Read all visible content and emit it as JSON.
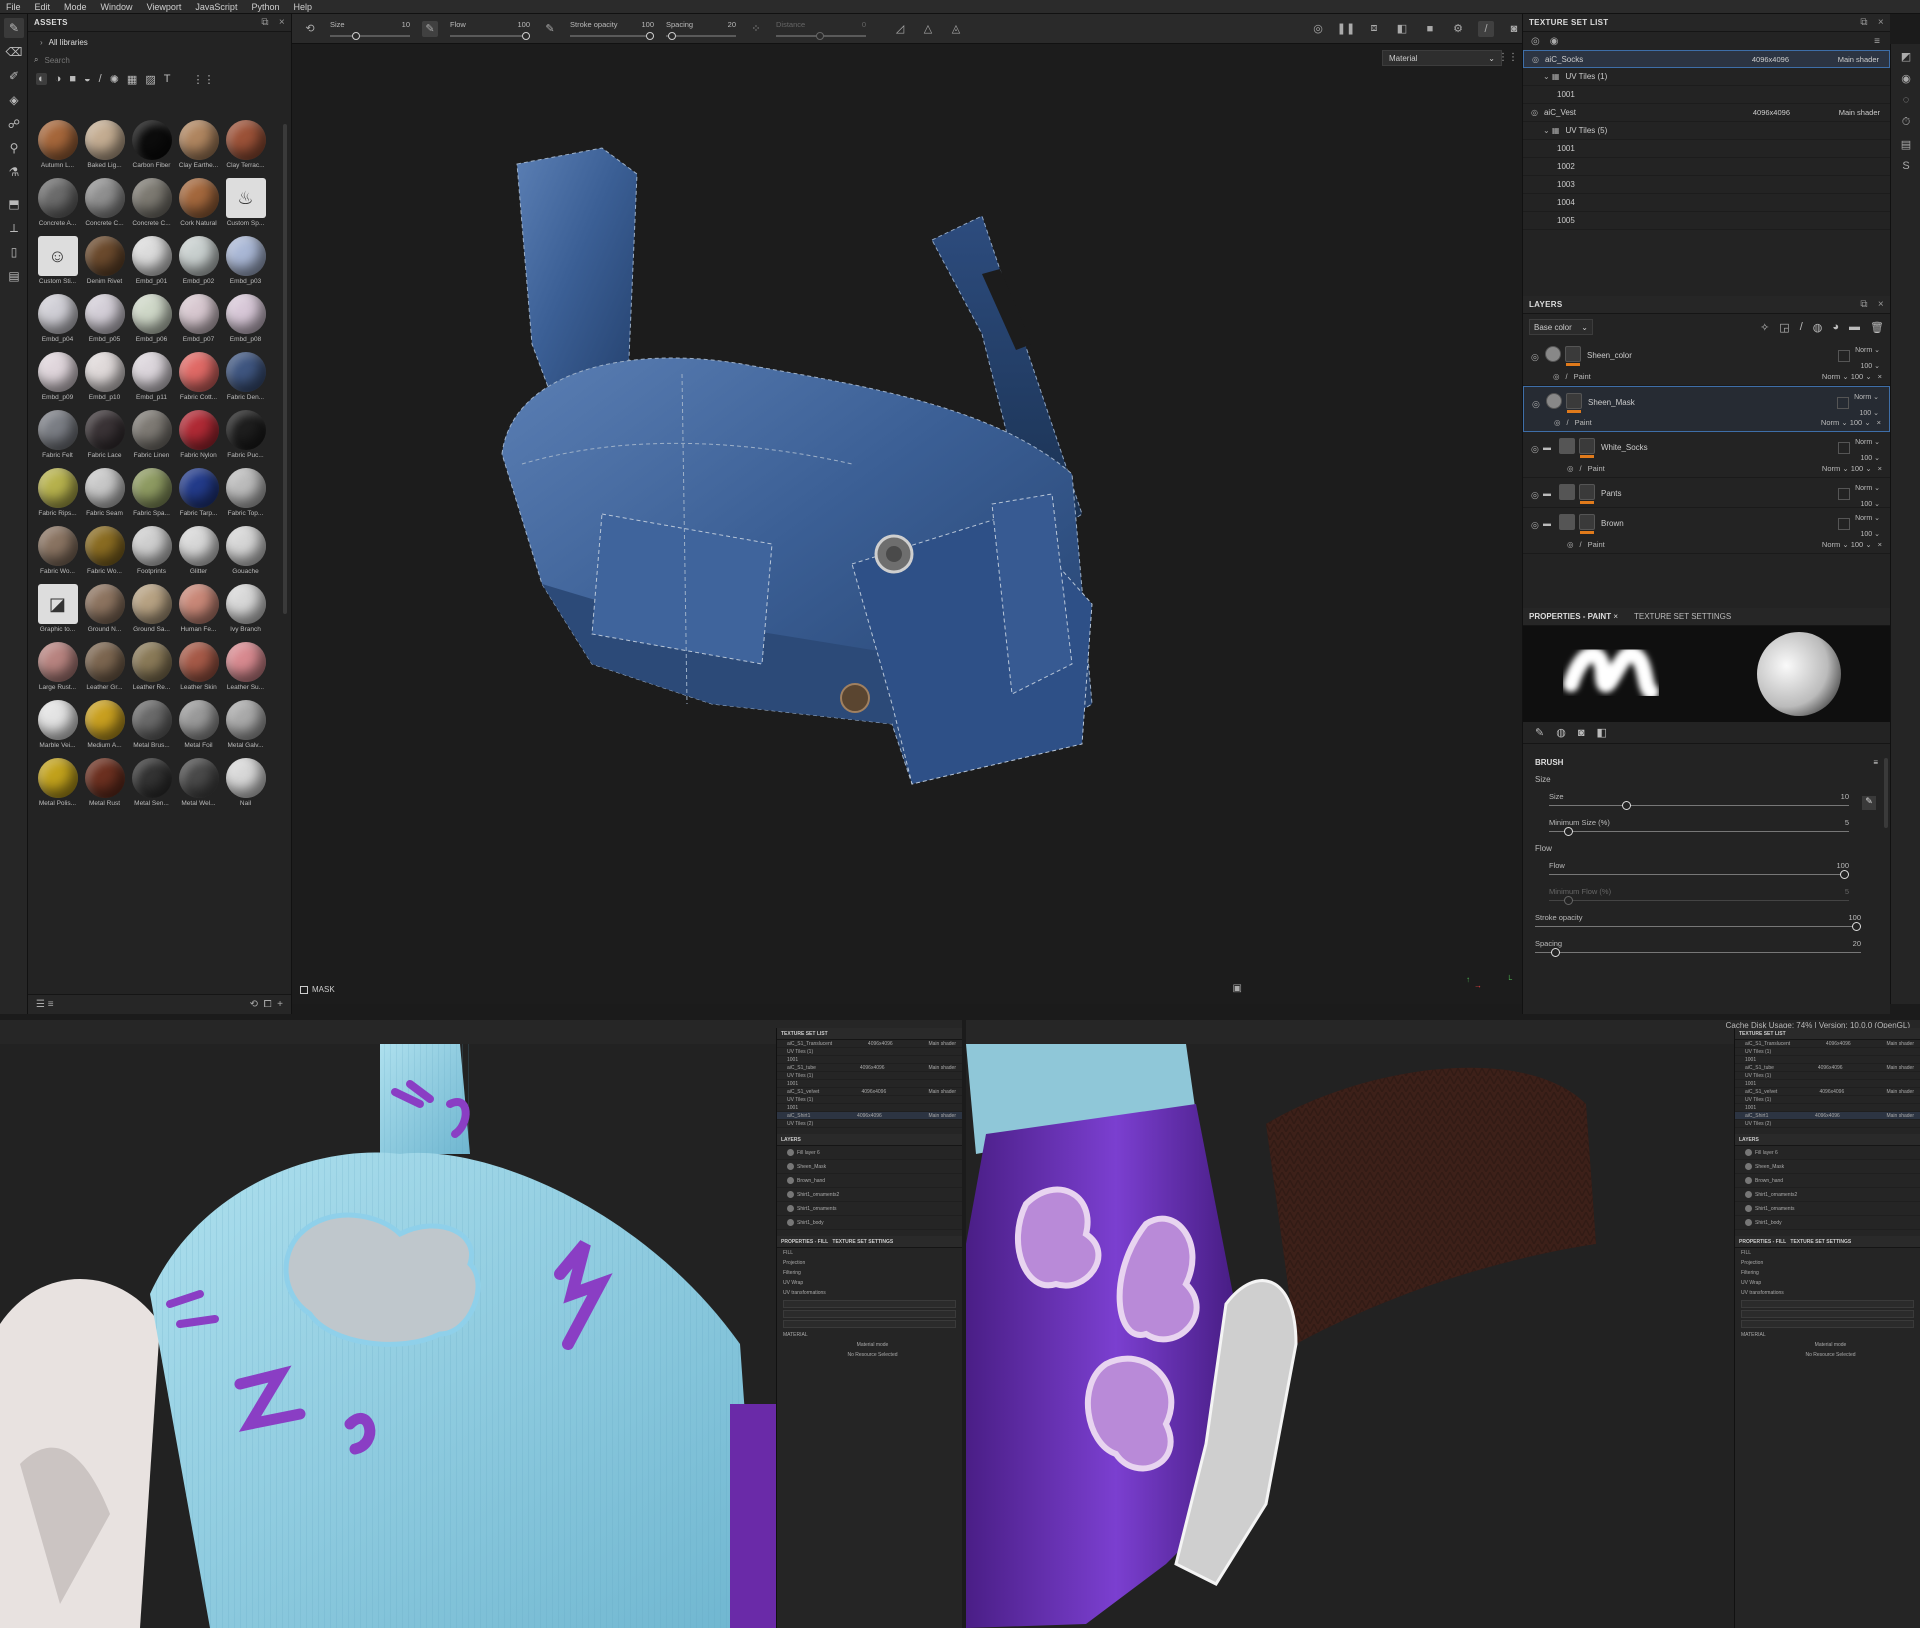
{
  "menu": [
    "File",
    "Edit",
    "Mode",
    "Window",
    "Viewport",
    "JavaScript",
    "Python",
    "Help"
  ],
  "assets": {
    "title": "ASSETS",
    "breadcrumb": "All libraries",
    "search_placeholder": "Search",
    "items": [
      {
        "label": "Autumn L...",
        "color": "#a6673b"
      },
      {
        "label": "Baked Lig...",
        "color": "#c4ad92"
      },
      {
        "label": "Carbon Fiber",
        "color": "#0c0c0c"
      },
      {
        "label": "Clay Earthe...",
        "color": "#b08660"
      },
      {
        "label": "Clay Terrac...",
        "color": "#9c5238"
      },
      {
        "label": "Concrete A...",
        "color": "#6c6c6c"
      },
      {
        "label": "Concrete C...",
        "color": "#909090"
      },
      {
        "label": "Concrete C...",
        "color": "#7d7a72"
      },
      {
        "label": "Cork Natural",
        "color": "#a4683d"
      },
      {
        "label": "Custom Sp...",
        "color": "#dddddd",
        "icon": "spray-icon"
      },
      {
        "label": "Custom Sti...",
        "color": "#dddddd",
        "icon": "smiley-icon"
      },
      {
        "label": "Denim Rivet",
        "color": "#6b4a2d"
      },
      {
        "label": "Embd_p01",
        "color": "#dcdcdc"
      },
      {
        "label": "Embd_p02",
        "color": "#c9d0cf"
      },
      {
        "label": "Embd_p03",
        "color": "#aab8d6"
      },
      {
        "label": "Embd_p04",
        "color": "#d0cfd6"
      },
      {
        "label": "Embd_p05",
        "color": "#d4cfd8"
      },
      {
        "label": "Embd_p06",
        "color": "#cfd8c8"
      },
      {
        "label": "Embd_p07",
        "color": "#d8c8d0"
      },
      {
        "label": "Embd_p08",
        "color": "#d8c8d8"
      },
      {
        "label": "Embd_p09",
        "color": "#e0d6dc"
      },
      {
        "label": "Embd_p10",
        "color": "#e0dada"
      },
      {
        "label": "Embd_p11",
        "color": "#dcd6dc"
      },
      {
        "label": "Fabric Cott...",
        "color": "#e06a66"
      },
      {
        "label": "Fabric Den...",
        "color": "#3f5680"
      },
      {
        "label": "Fabric Felt",
        "color": "#7b7e85"
      },
      {
        "label": "Fabric Lace",
        "color": "#3a3336"
      },
      {
        "label": "Fabric Linen",
        "color": "#7e7a74"
      },
      {
        "label": "Fabric Nylon",
        "color": "#b02a35"
      },
      {
        "label": "Fabric Puc...",
        "color": "#1e1e1e"
      },
      {
        "label": "Fabric Rips...",
        "color": "#b7b24d"
      },
      {
        "label": "Fabric Seam",
        "color": "#c8c8c8"
      },
      {
        "label": "Fabric Spa...",
        "color": "#8e9b62"
      },
      {
        "label": "Fabric Tarp...",
        "color": "#233b8a"
      },
      {
        "label": "Fabric Top...",
        "color": "#bcbcbc"
      },
      {
        "label": "Fabric Wo...",
        "color": "#8a7462"
      },
      {
        "label": "Fabric Wo...",
        "color": "#8a6c22"
      },
      {
        "label": "Footprints",
        "color": "#cfcfcf"
      },
      {
        "label": "Glitter",
        "color": "#d8d8d8"
      },
      {
        "label": "Gouache",
        "color": "#d6d6d6"
      },
      {
        "label": "Graphic to...",
        "color": "#dddddd",
        "icon": "graphic-tool-icon"
      },
      {
        "label": "Ground N...",
        "color": "#8d7460"
      },
      {
        "label": "Ground Sa...",
        "color": "#b7a283"
      },
      {
        "label": "Human Fe...",
        "color": "#c98878"
      },
      {
        "label": "Ivy Branch",
        "color": "#d8d8d8"
      },
      {
        "label": "Large Rust...",
        "color": "#b88480"
      },
      {
        "label": "Leather Gr...",
        "color": "#7c6650"
      },
      {
        "label": "Leather Re...",
        "color": "#8a7a58"
      },
      {
        "label": "Leather Skin",
        "color": "#a65a48"
      },
      {
        "label": "Leather Su...",
        "color": "#d88a90"
      },
      {
        "label": "Marble Vei...",
        "color": "#e4e4e4"
      },
      {
        "label": "Medium A...",
        "color": "#c9a020"
      },
      {
        "label": "Metal Brus...",
        "color": "#6a6a6a"
      },
      {
        "label": "Metal Foil",
        "color": "#9a9a9a"
      },
      {
        "label": "Metal Galv...",
        "color": "#aaaaaa"
      },
      {
        "label": "Metal Polis...",
        "color": "#c2a21c"
      },
      {
        "label": "Metal Rust",
        "color": "#6c3020"
      },
      {
        "label": "Metal Sen...",
        "color": "#333333"
      },
      {
        "label": "Metal Wel...",
        "color": "#4a4a4a"
      },
      {
        "label": "Nail",
        "color": "#d8d8d8"
      }
    ]
  },
  "toolbar": {
    "size": {
      "label": "Size",
      "value": "10"
    },
    "flow": {
      "label": "Flow",
      "value": "100"
    },
    "stroke_opacity": {
      "label": "Stroke opacity",
      "value": "100"
    },
    "spacing": {
      "label": "Spacing",
      "value": "20"
    },
    "distance": {
      "label": "Distance",
      "value": "0"
    }
  },
  "viewport": {
    "mode": "Material",
    "mask_label": "MASK"
  },
  "texture_set_list": {
    "title": "TEXTURE SET LIST",
    "rows": [
      {
        "name": "aiC_Socks",
        "res": "4096x4096",
        "shader": "Main shader",
        "level": 0,
        "selected": true
      },
      {
        "name": "UV Tiles (1)",
        "level": 1
      },
      {
        "name": "1001",
        "level": 2
      },
      {
        "name": "aiC_Vest",
        "res": "4096x4096",
        "shader": "Main shader",
        "level": 0
      },
      {
        "name": "UV Tiles (5)",
        "level": 1
      },
      {
        "name": "1001",
        "level": 2
      },
      {
        "name": "1002",
        "level": 2
      },
      {
        "name": "1003",
        "level": 2
      },
      {
        "name": "1004",
        "level": 2
      },
      {
        "name": "1005",
        "level": 2
      }
    ]
  },
  "layers": {
    "title": "LAYERS",
    "channel": "Base color",
    "items": [
      {
        "name": "Sheen_color",
        "blend": "Norm",
        "opacity": "100",
        "sub": "Paint",
        "sub_blend": "Norm",
        "sub_opacity": "100",
        "folder": false
      },
      {
        "name": "Sheen_Mask",
        "blend": "Norm",
        "opacity": "100",
        "sub": "Paint",
        "sub_blend": "Norm",
        "sub_opacity": "100",
        "folder": false,
        "selected": true
      },
      {
        "name": "White_Socks",
        "blend": "Norm",
        "opacity": "100",
        "sub": "Paint",
        "sub_blend": "Norm",
        "sub_opacity": "100",
        "folder": true
      },
      {
        "name": "Pants",
        "blend": "Norm",
        "opacity": "100",
        "folder": true
      },
      {
        "name": "Brown",
        "blend": "Norm",
        "opacity": "100",
        "sub": "Paint",
        "sub_blend": "Norm",
        "sub_opacity": "100",
        "folder": true
      }
    ]
  },
  "properties": {
    "tab_active": "PROPERTIES - PAINT",
    "tab_other": "TEXTURE SET SETTINGS",
    "section": "BRUSH",
    "size_group": "Size",
    "size": {
      "label": "Size",
      "value": "10",
      "fraction": 0.25
    },
    "min_size": {
      "label": "Minimum Size (%)",
      "value": "5",
      "fraction": 0.05
    },
    "flow_group": "Flow",
    "flow": {
      "label": "Flow",
      "value": "100",
      "fraction": 1.0
    },
    "min_flow": {
      "label": "Minimum Flow (%)",
      "value": "5",
      "fraction": 0.05
    },
    "stroke_opacity": {
      "label": "Stroke opacity",
      "value": "100",
      "fraction": 1.0
    },
    "spacing": {
      "label": "Spacing",
      "value": "20",
      "fraction": 0.05
    }
  },
  "bottom": {
    "status": "Cache Disk Usage:   74% | Version: 10.0.0 (OpenGL)",
    "panel_title": "TEXTURE SET LIST",
    "sets": [
      {
        "name": "aiC_S1_Translucent",
        "res": "4096x4096",
        "shader": "Main shader"
      },
      {
        "name": "UV Tiles (1)"
      },
      {
        "name": "1001"
      },
      {
        "name": "aiC_S1_tube",
        "res": "4096x4096",
        "shader": "Main shader"
      },
      {
        "name": "UV Tiles (1)"
      },
      {
        "name": "1001"
      },
      {
        "name": "aiC_S1_velvet",
        "res": "4096x4096",
        "shader": "Main shader"
      },
      {
        "name": "UV Tiles (1)"
      },
      {
        "name": "1001"
      },
      {
        "name": "aiC_Shirt1",
        "res": "4096x4096",
        "shader": "Main shader"
      },
      {
        "name": "UV Tiles (2)"
      }
    ],
    "layers_title": "LAYERS",
    "layers": [
      "Fill layer 6",
      "Sheen_Mask",
      "Brown_hand",
      "Shirt1_ornaments2",
      "Shirt1_ornaments",
      "Shirt1_body"
    ],
    "props_tab": "PROPERTIES - FILL",
    "props_other": "TEXTURE SET SETTINGS",
    "fill": "FILL",
    "fill_rows": [
      "Projection",
      "Filtering",
      "UV Wrap"
    ],
    "uv_title": "UV transformations",
    "material": "MATERIAL",
    "material_mode": "Material mode",
    "no_resource": "No Resource Selected"
  },
  "colors": {
    "accent_blue": "#3e6ea8",
    "accent_orange": "#e07a1b"
  }
}
